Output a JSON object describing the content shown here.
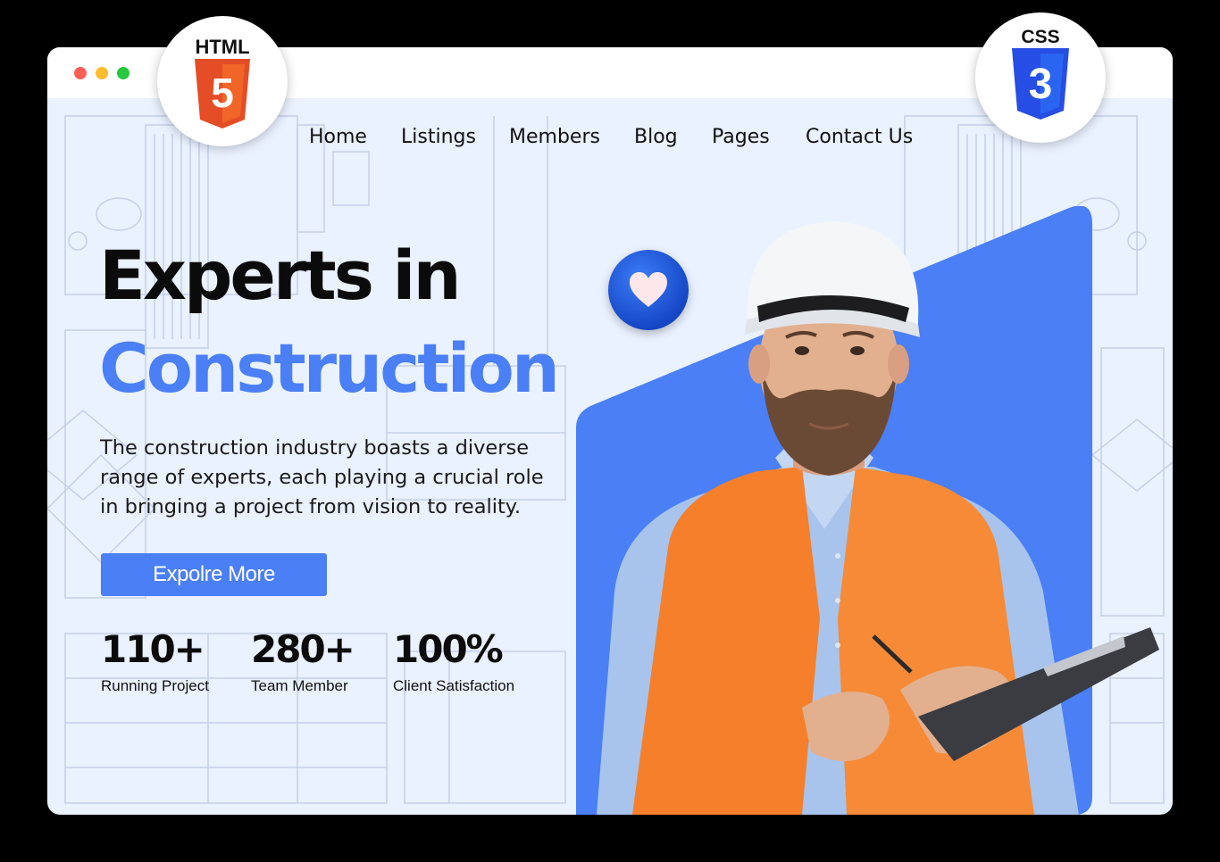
{
  "browser": {
    "window_dots": [
      "red",
      "yellow",
      "green"
    ],
    "colors": {
      "red": "#ff5f57",
      "yellow": "#febc2e",
      "green": "#28c840"
    }
  },
  "badges": {
    "html": {
      "label": "HTML",
      "glyph": "5",
      "icon": "html5-shield-icon",
      "color": "#e44d26"
    },
    "css": {
      "label": "CSS",
      "glyph": "3",
      "icon": "css3-shield-icon",
      "color": "#264de4"
    }
  },
  "nav": {
    "items": [
      {
        "label": "Home"
      },
      {
        "label": "Listings"
      },
      {
        "label": "Members"
      },
      {
        "label": "Blog"
      },
      {
        "label": "Pages"
      },
      {
        "label": "Contact Us"
      }
    ]
  },
  "hero": {
    "title_line1": "Experts in",
    "title_line2": "Construction",
    "description": "The construction industry boasts a diverse range of experts, each playing a crucial role in bringing a project from vision to reality.",
    "cta_label": "Expolre More"
  },
  "stats": [
    {
      "value": "110+",
      "label": "Running Project"
    },
    {
      "value": "280+",
      "label": "Team Member"
    },
    {
      "value": "100%",
      "label": "Client Satisfaction"
    }
  ],
  "image": {
    "icon": "heart-icon",
    "subject": "construction-worker-photo"
  },
  "colors": {
    "accent": "#4a7ff5",
    "background": "#eaf1ff",
    "vest": "#f57f2a",
    "heart_badge": "#1547c6"
  }
}
